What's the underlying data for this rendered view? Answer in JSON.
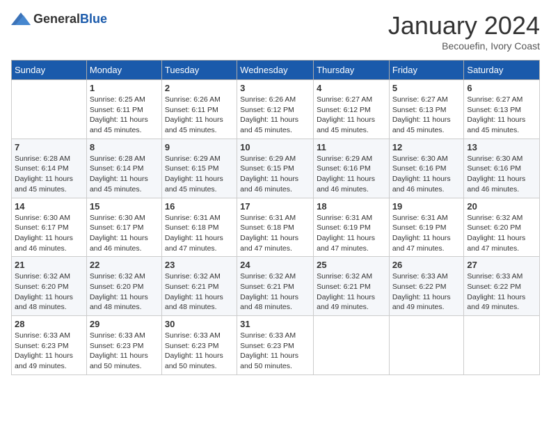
{
  "header": {
    "logo_general": "General",
    "logo_blue": "Blue",
    "month_title": "January 2024",
    "subtitle": "Becouefin, Ivory Coast"
  },
  "days_of_week": [
    "Sunday",
    "Monday",
    "Tuesday",
    "Wednesday",
    "Thursday",
    "Friday",
    "Saturday"
  ],
  "weeks": [
    [
      {
        "day": "",
        "sunrise": "",
        "sunset": "",
        "daylight": ""
      },
      {
        "day": "1",
        "sunrise": "Sunrise: 6:25 AM",
        "sunset": "Sunset: 6:11 PM",
        "daylight": "Daylight: 11 hours and 45 minutes."
      },
      {
        "day": "2",
        "sunrise": "Sunrise: 6:26 AM",
        "sunset": "Sunset: 6:11 PM",
        "daylight": "Daylight: 11 hours and 45 minutes."
      },
      {
        "day": "3",
        "sunrise": "Sunrise: 6:26 AM",
        "sunset": "Sunset: 6:12 PM",
        "daylight": "Daylight: 11 hours and 45 minutes."
      },
      {
        "day": "4",
        "sunrise": "Sunrise: 6:27 AM",
        "sunset": "Sunset: 6:12 PM",
        "daylight": "Daylight: 11 hours and 45 minutes."
      },
      {
        "day": "5",
        "sunrise": "Sunrise: 6:27 AM",
        "sunset": "Sunset: 6:13 PM",
        "daylight": "Daylight: 11 hours and 45 minutes."
      },
      {
        "day": "6",
        "sunrise": "Sunrise: 6:27 AM",
        "sunset": "Sunset: 6:13 PM",
        "daylight": "Daylight: 11 hours and 45 minutes."
      }
    ],
    [
      {
        "day": "7",
        "sunrise": "Sunrise: 6:28 AM",
        "sunset": "Sunset: 6:14 PM",
        "daylight": "Daylight: 11 hours and 45 minutes."
      },
      {
        "day": "8",
        "sunrise": "Sunrise: 6:28 AM",
        "sunset": "Sunset: 6:14 PM",
        "daylight": "Daylight: 11 hours and 45 minutes."
      },
      {
        "day": "9",
        "sunrise": "Sunrise: 6:29 AM",
        "sunset": "Sunset: 6:15 PM",
        "daylight": "Daylight: 11 hours and 45 minutes."
      },
      {
        "day": "10",
        "sunrise": "Sunrise: 6:29 AM",
        "sunset": "Sunset: 6:15 PM",
        "daylight": "Daylight: 11 hours and 46 minutes."
      },
      {
        "day": "11",
        "sunrise": "Sunrise: 6:29 AM",
        "sunset": "Sunset: 6:16 PM",
        "daylight": "Daylight: 11 hours and 46 minutes."
      },
      {
        "day": "12",
        "sunrise": "Sunrise: 6:30 AM",
        "sunset": "Sunset: 6:16 PM",
        "daylight": "Daylight: 11 hours and 46 minutes."
      },
      {
        "day": "13",
        "sunrise": "Sunrise: 6:30 AM",
        "sunset": "Sunset: 6:16 PM",
        "daylight": "Daylight: 11 hours and 46 minutes."
      }
    ],
    [
      {
        "day": "14",
        "sunrise": "Sunrise: 6:30 AM",
        "sunset": "Sunset: 6:17 PM",
        "daylight": "Daylight: 11 hours and 46 minutes."
      },
      {
        "day": "15",
        "sunrise": "Sunrise: 6:30 AM",
        "sunset": "Sunset: 6:17 PM",
        "daylight": "Daylight: 11 hours and 46 minutes."
      },
      {
        "day": "16",
        "sunrise": "Sunrise: 6:31 AM",
        "sunset": "Sunset: 6:18 PM",
        "daylight": "Daylight: 11 hours and 47 minutes."
      },
      {
        "day": "17",
        "sunrise": "Sunrise: 6:31 AM",
        "sunset": "Sunset: 6:18 PM",
        "daylight": "Daylight: 11 hours and 47 minutes."
      },
      {
        "day": "18",
        "sunrise": "Sunrise: 6:31 AM",
        "sunset": "Sunset: 6:19 PM",
        "daylight": "Daylight: 11 hours and 47 minutes."
      },
      {
        "day": "19",
        "sunrise": "Sunrise: 6:31 AM",
        "sunset": "Sunset: 6:19 PM",
        "daylight": "Daylight: 11 hours and 47 minutes."
      },
      {
        "day": "20",
        "sunrise": "Sunrise: 6:32 AM",
        "sunset": "Sunset: 6:20 PM",
        "daylight": "Daylight: 11 hours and 47 minutes."
      }
    ],
    [
      {
        "day": "21",
        "sunrise": "Sunrise: 6:32 AM",
        "sunset": "Sunset: 6:20 PM",
        "daylight": "Daylight: 11 hours and 48 minutes."
      },
      {
        "day": "22",
        "sunrise": "Sunrise: 6:32 AM",
        "sunset": "Sunset: 6:20 PM",
        "daylight": "Daylight: 11 hours and 48 minutes."
      },
      {
        "day": "23",
        "sunrise": "Sunrise: 6:32 AM",
        "sunset": "Sunset: 6:21 PM",
        "daylight": "Daylight: 11 hours and 48 minutes."
      },
      {
        "day": "24",
        "sunrise": "Sunrise: 6:32 AM",
        "sunset": "Sunset: 6:21 PM",
        "daylight": "Daylight: 11 hours and 48 minutes."
      },
      {
        "day": "25",
        "sunrise": "Sunrise: 6:32 AM",
        "sunset": "Sunset: 6:21 PM",
        "daylight": "Daylight: 11 hours and 49 minutes."
      },
      {
        "day": "26",
        "sunrise": "Sunrise: 6:33 AM",
        "sunset": "Sunset: 6:22 PM",
        "daylight": "Daylight: 11 hours and 49 minutes."
      },
      {
        "day": "27",
        "sunrise": "Sunrise: 6:33 AM",
        "sunset": "Sunset: 6:22 PM",
        "daylight": "Daylight: 11 hours and 49 minutes."
      }
    ],
    [
      {
        "day": "28",
        "sunrise": "Sunrise: 6:33 AM",
        "sunset": "Sunset: 6:23 PM",
        "daylight": "Daylight: 11 hours and 49 minutes."
      },
      {
        "day": "29",
        "sunrise": "Sunrise: 6:33 AM",
        "sunset": "Sunset: 6:23 PM",
        "daylight": "Daylight: 11 hours and 50 minutes."
      },
      {
        "day": "30",
        "sunrise": "Sunrise: 6:33 AM",
        "sunset": "Sunset: 6:23 PM",
        "daylight": "Daylight: 11 hours and 50 minutes."
      },
      {
        "day": "31",
        "sunrise": "Sunrise: 6:33 AM",
        "sunset": "Sunset: 6:23 PM",
        "daylight": "Daylight: 11 hours and 50 minutes."
      },
      {
        "day": "",
        "sunrise": "",
        "sunset": "",
        "daylight": ""
      },
      {
        "day": "",
        "sunrise": "",
        "sunset": "",
        "daylight": ""
      },
      {
        "day": "",
        "sunrise": "",
        "sunset": "",
        "daylight": ""
      }
    ]
  ]
}
